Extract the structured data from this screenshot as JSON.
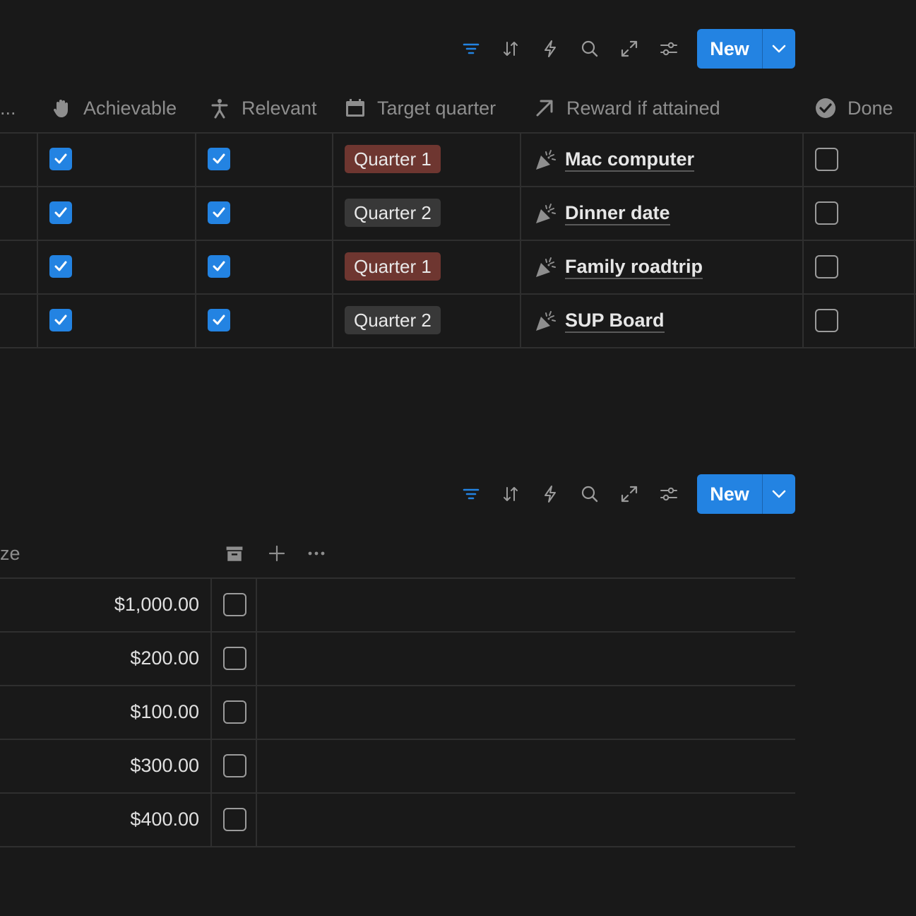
{
  "toolbar_top": {
    "new_label": "New"
  },
  "toolbar_bottom": {
    "new_label": "New"
  },
  "table1": {
    "truncated_header": "...",
    "headers": {
      "achievable": "Achievable",
      "relevant": "Relevant",
      "target_quarter": "Target quarter",
      "reward": "Reward if attained",
      "done": "Done"
    },
    "rows": [
      {
        "achievable": true,
        "relevant": true,
        "quarter": "Quarter 1",
        "quarter_color": "#6e3630",
        "reward": "Mac computer",
        "done": false
      },
      {
        "achievable": true,
        "relevant": true,
        "quarter": "Quarter 2",
        "quarter_color": "#383838",
        "reward": "Dinner date",
        "done": false
      },
      {
        "achievable": true,
        "relevant": true,
        "quarter": "Quarter 1",
        "quarter_color": "#6e3630",
        "reward": "Family roadtrip",
        "done": false
      },
      {
        "achievable": true,
        "relevant": true,
        "quarter": "Quarter 2",
        "quarter_color": "#383838",
        "reward": "SUP Board",
        "done": false
      }
    ]
  },
  "table2": {
    "partial_header": "ze",
    "rows": [
      {
        "price": "$1,000.00",
        "archived": false
      },
      {
        "price": "$200.00",
        "archived": false
      },
      {
        "price": "$100.00",
        "archived": false
      },
      {
        "price": "$300.00",
        "archived": false
      },
      {
        "price": "$400.00",
        "archived": false
      }
    ]
  },
  "colors": {
    "accent": "#2383e2",
    "background": "#191919",
    "quarter1": "#6e3630",
    "quarter2": "#383838"
  },
  "icons": [
    "filter-icon",
    "sort-icon",
    "automation-icon",
    "search-icon",
    "expand-icon",
    "settings-icon",
    "chevron-down-icon",
    "hand-icon",
    "person-icon",
    "calendar-icon",
    "arrow-up-right-icon",
    "check-circle-icon",
    "party-popper-icon",
    "archive-icon",
    "plus-icon",
    "more-icon"
  ]
}
